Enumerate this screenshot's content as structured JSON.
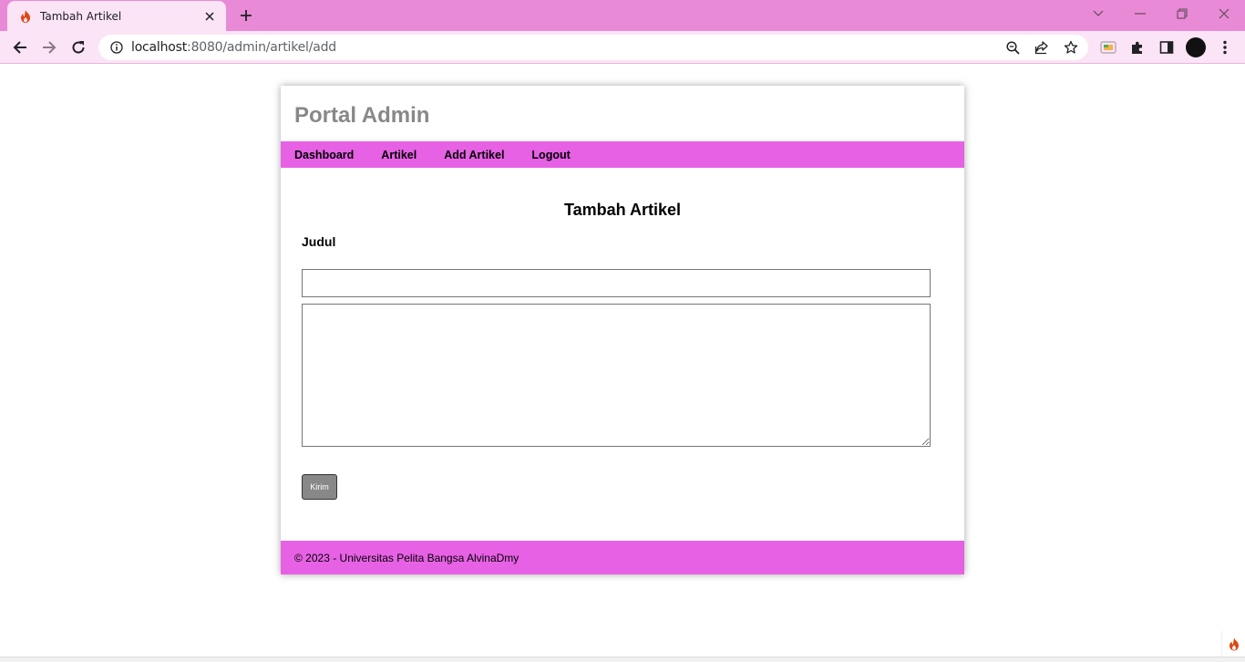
{
  "browser": {
    "tab_title": "Tambah Artikel",
    "url_host": "localhost",
    "url_rest": ":8080/admin/artikel/add",
    "accent_color": "#e98ad6"
  },
  "site": {
    "title": "Portal Admin",
    "nav": {
      "dashboard": "Dashboard",
      "artikel": "Artikel",
      "add_artikel": "Add Artikel",
      "logout": "Logout"
    },
    "nav_color": "#e761e5"
  },
  "form": {
    "heading": "Tambah Artikel",
    "judul_label": "Judul",
    "judul_value": "",
    "isi_value": "",
    "submit_label": "Kirim"
  },
  "footer": {
    "text": "© 2023 - Universitas Pelita Bangsa AlvinaDmy"
  },
  "icons": [
    "codeigniter-flame-icon",
    "close-icon",
    "plus-icon",
    "chevron-down-icon",
    "minimize-icon",
    "restore-icon",
    "window-close-icon",
    "back-icon",
    "forward-icon",
    "reload-icon",
    "info-icon",
    "zoom-icon",
    "share-icon",
    "star-icon",
    "cast-icon",
    "extensions-icon",
    "sidepanel-icon",
    "menu-icon"
  ]
}
